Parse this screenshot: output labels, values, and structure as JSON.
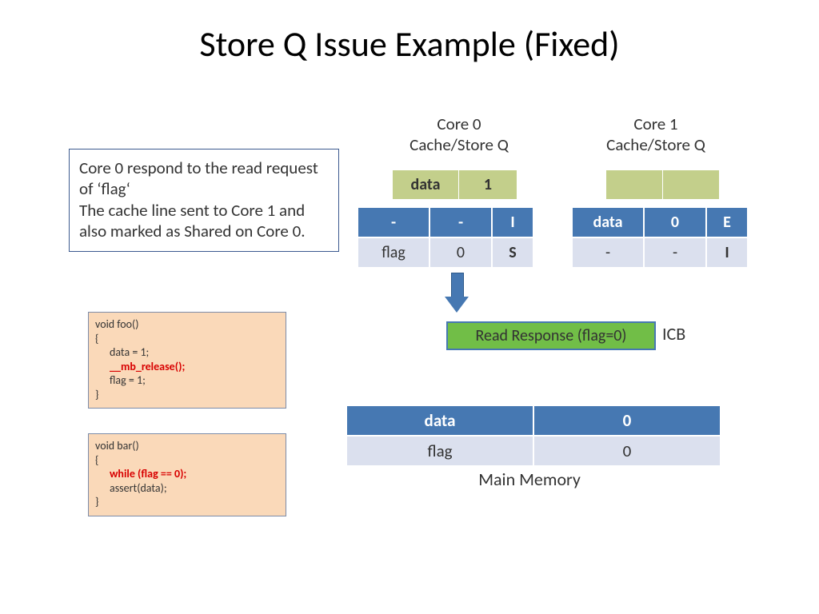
{
  "title": "Store Q Issue Example (Fixed)",
  "explain": "Core 0 respond to the read request of 'flag'\nThe cache line sent to Core 1 and also marked as Shared on Core 0.",
  "code": {
    "foo": {
      "sig": "void foo()",
      "open": "{",
      "l1": "data = 1;",
      "l2": "__mb_release();",
      "l3": "flag = 1;",
      "close": "}"
    },
    "bar": {
      "sig": "void bar()",
      "open": "{",
      "l1": "while (flag == 0);",
      "l2": "assert(data);",
      "close": "}"
    }
  },
  "core0": {
    "label": "Core 0\nCache/Store Q",
    "storeq": {
      "c1": "data",
      "c2": "1"
    },
    "cache": [
      {
        "c1": "-",
        "c2": "-",
        "c3": "I"
      },
      {
        "c1": "flag",
        "c2": "0",
        "c3": "S"
      }
    ]
  },
  "core1": {
    "label": "Core 1\nCache/Store Q",
    "storeq": {
      "c1": "",
      "c2": ""
    },
    "cache": [
      {
        "c1": "data",
        "c2": "0",
        "c3": "E"
      },
      {
        "c1": "-",
        "c2": "-",
        "c3": "I"
      }
    ]
  },
  "response": "Read Response (flag=0)",
  "icb": "ICB",
  "memory": {
    "rows": [
      {
        "name": "data",
        "val": "0"
      },
      {
        "name": "flag",
        "val": "0"
      }
    ],
    "label": "Main Memory"
  }
}
